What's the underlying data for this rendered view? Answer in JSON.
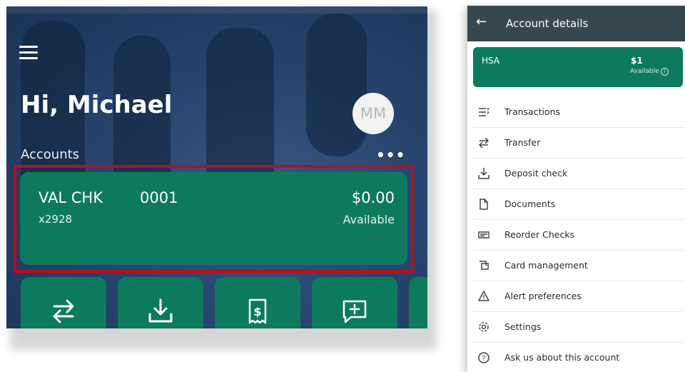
{
  "left": {
    "greeting": "Hi, Michael",
    "avatar_initials": "MM",
    "accounts_label": "Accounts",
    "more_icon": "more-horizontal-icon",
    "account": {
      "name": "VAL CHK",
      "number": "0001",
      "masked": "x2928",
      "balance": "$0.00",
      "balance_label": "Available"
    },
    "quick_actions": [
      "transfer-icon",
      "deposit-icon",
      "bill-pay-icon",
      "message-icon"
    ]
  },
  "right": {
    "title": "Account details",
    "back_icon": "back-arrow-icon",
    "hsa": {
      "name": "HSA",
      "balance": "$1",
      "balance_label": "Available",
      "info_icon": "i"
    },
    "menu": [
      {
        "label": "Transactions",
        "icon": "list-icon"
      },
      {
        "label": "Transfer",
        "icon": "transfer-icon"
      },
      {
        "label": "Deposit check",
        "icon": "deposit-icon"
      },
      {
        "label": "Documents",
        "icon": "document-icon"
      },
      {
        "label": "Reorder Checks",
        "icon": "checkbook-icon"
      },
      {
        "label": "Card management",
        "icon": "cards-icon"
      },
      {
        "label": "Alert preferences",
        "icon": "alert-icon"
      },
      {
        "label": "Settings",
        "icon": "gear-icon"
      },
      {
        "label": "Ask us about this account",
        "icon": "help-icon"
      }
    ]
  },
  "colors": {
    "card_green": "#0d7a5e",
    "header_dark": "#37474f",
    "highlight_red": "#c20d14"
  }
}
